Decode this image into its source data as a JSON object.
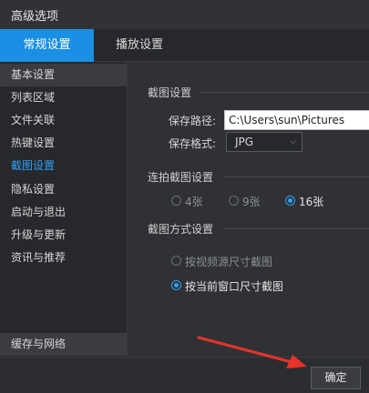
{
  "window": {
    "title": "高级选项"
  },
  "tabs": [
    {
      "label": "常规设置",
      "active": true
    },
    {
      "label": "播放设置",
      "active": false
    }
  ],
  "sidebar": {
    "items": [
      {
        "label": "基本设置"
      },
      {
        "label": "列表区域"
      },
      {
        "label": "文件关联"
      },
      {
        "label": "热键设置"
      },
      {
        "label": "截图设置",
        "current": true
      },
      {
        "label": "隐私设置"
      },
      {
        "label": "启动与退出"
      },
      {
        "label": "升级与更新"
      },
      {
        "label": "资讯与推荐"
      }
    ],
    "bottom_item": {
      "label": "缓存与网络"
    }
  },
  "screenshot_settings": {
    "section_title": "截图设置",
    "save_path_label": "保存路径:",
    "save_path_value": "C:\\Users\\sun\\Pictures",
    "save_format_label": "保存格式:",
    "save_format_value": "JPG"
  },
  "burst_settings": {
    "section_title": "连拍截图设置",
    "options": [
      {
        "label": "4张",
        "selected": false
      },
      {
        "label": "9张",
        "selected": false
      },
      {
        "label": "16张",
        "selected": true
      }
    ]
  },
  "capture_mode": {
    "section_title": "截图方式设置",
    "options": [
      {
        "label": "按视频源尺寸截图",
        "selected": false
      },
      {
        "label": "按当前窗口尺寸截图",
        "selected": true
      }
    ]
  },
  "footer": {
    "ok_label": "确定"
  },
  "colors": {
    "accent": "#1a8fe3",
    "selected_text": "#2f9ff8",
    "annotation_arrow": "#e8322b"
  }
}
